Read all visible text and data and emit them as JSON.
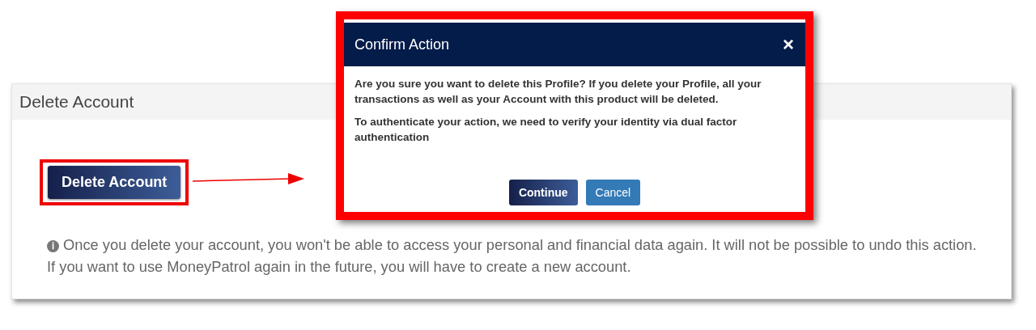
{
  "panel": {
    "title": "Delete Account",
    "button": "Delete Account",
    "info_icon": "ℹ",
    "info": "Once you delete your account, you won't be able to access your personal and financial data again. It will not be possible to undo this action. If you want to use MoneyPatrol again in the future, you will have to create a new account."
  },
  "modal": {
    "title": "Confirm Action",
    "close": "×",
    "paragraphs": [
      "Are you sure you want to delete this Profile? If you delete your Profile, all your transactions as well as your Account with this product will be deleted.",
      "To authenticate your action, we need to verify your identity via dual factor authentication"
    ],
    "buttons": [
      {
        "label": "Continue",
        "kind": "primary"
      },
      {
        "label": "Cancel",
        "kind": "secondary"
      }
    ]
  }
}
